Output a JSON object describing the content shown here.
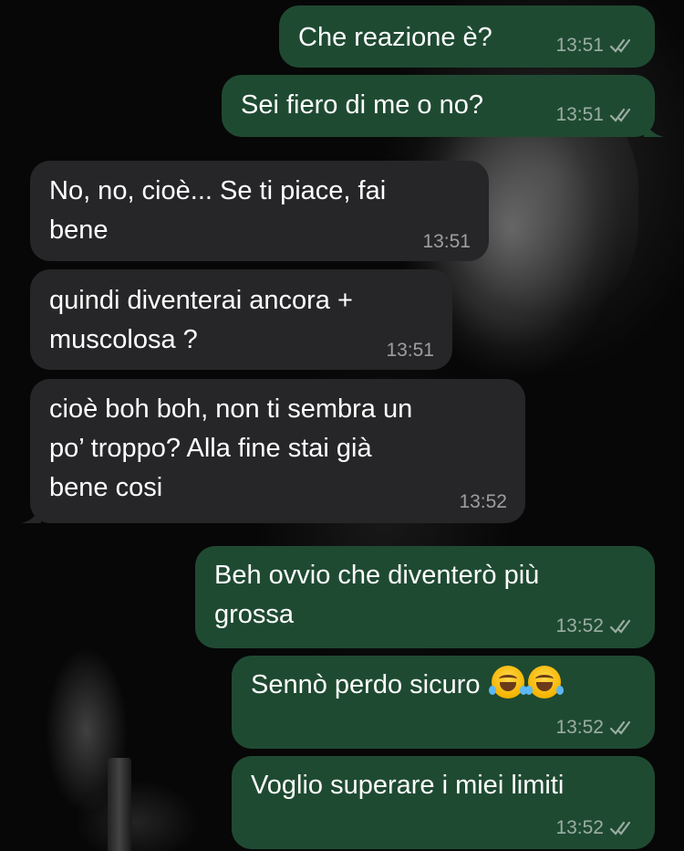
{
  "chat": {
    "messages": [
      {
        "id": "m1",
        "direction": "outgoing",
        "text": "Che reazione è?",
        "time": "13:51",
        "status": "read"
      },
      {
        "id": "m2",
        "direction": "outgoing",
        "text": "Sei fiero di me o no?",
        "time": "13:51",
        "status": "read"
      },
      {
        "id": "m3",
        "direction": "incoming",
        "lines": [
          "No, no, cioè... Se ti piace, fai",
          "bene"
        ],
        "time": "13:51"
      },
      {
        "id": "m4",
        "direction": "incoming",
        "lines": [
          "quindi diventerai ancora +",
          "muscolosa ?"
        ],
        "time": "13:51"
      },
      {
        "id": "m5",
        "direction": "incoming",
        "lines": [
          "cioè boh boh, non ti sembra un",
          "po’ troppo? Alla fine stai già",
          "bene cosi"
        ],
        "time": "13:52"
      },
      {
        "id": "m6",
        "direction": "outgoing",
        "lines": [
          "Beh ovvio che diventerò più",
          "grossa"
        ],
        "time": "13:52",
        "status": "read"
      },
      {
        "id": "m7",
        "direction": "outgoing",
        "text": "Sennò perdo sicuro",
        "emoji": [
          "face-with-tears-of-joy",
          "face-with-tears-of-joy"
        ],
        "time": "13:52",
        "status": "read"
      },
      {
        "id": "m8",
        "direction": "outgoing",
        "text": "Voglio superare i miei limiti",
        "time": "13:52",
        "status": "read"
      }
    ]
  },
  "colors": {
    "outgoing_bubble": "#1f4a32",
    "incoming_bubble": "#262628",
    "text": "#ffffff",
    "meta": "#9a9a9a"
  },
  "icons": {
    "read_receipt": "double-check-icon",
    "emoji": "face-with-tears-of-joy-icon"
  }
}
